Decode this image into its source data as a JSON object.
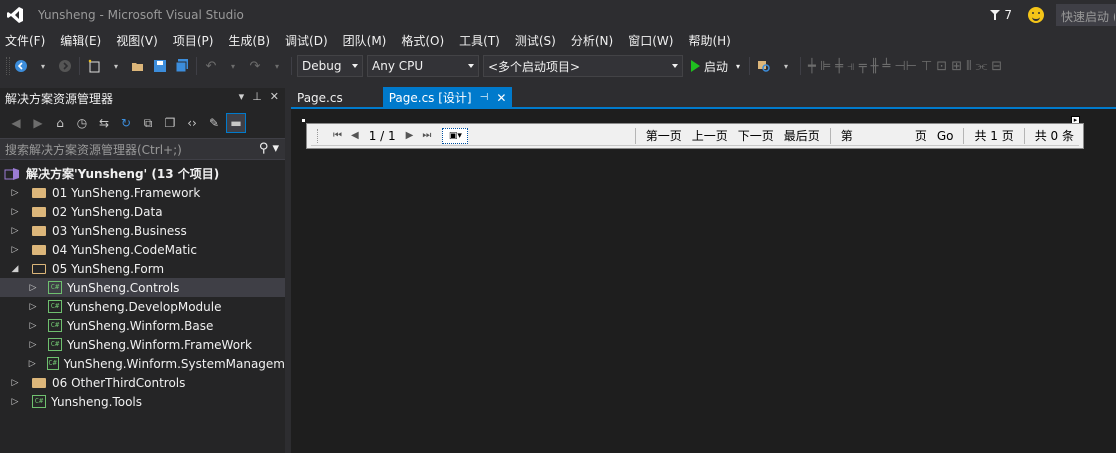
{
  "window": {
    "title": "Yunsheng - Microsoft Visual Studio",
    "notifications_count": "7",
    "quick_launch_placeholder": "快速启动 (",
    "accent_color": "#007acc"
  },
  "menu": [
    "文件(F)",
    "编辑(E)",
    "视图(V)",
    "项目(P)",
    "生成(B)",
    "调试(D)",
    "团队(M)",
    "格式(O)",
    "工具(T)",
    "测试(S)",
    "分析(N)",
    "窗口(W)",
    "帮助(H)"
  ],
  "toolbar": {
    "configuration": "Debug",
    "platform": "Any CPU",
    "startup_project": "<多个启动项目>",
    "start_label": "启动"
  },
  "solution_explorer": {
    "title": "解决方案资源管理器",
    "search_placeholder": "搜索解决方案资源管理器(Ctrl+;)",
    "solution_label": "解决方案'Yunsheng' (13 个项目)",
    "items": [
      {
        "label": "01 YunSheng.Framework",
        "type": "folder",
        "expander": "▷"
      },
      {
        "label": "02 YunSheng.Data",
        "type": "folder",
        "expander": "▷"
      },
      {
        "label": "03 YunSheng.Business",
        "type": "folder",
        "expander": "▷"
      },
      {
        "label": "04 YunSheng.CodeMatic",
        "type": "folder",
        "expander": "▷"
      },
      {
        "label": "05 YunSheng.Form",
        "type": "folder-open",
        "expander": "◢"
      },
      {
        "label": "YunSheng.Controls",
        "type": "csproj",
        "expander": "▷"
      },
      {
        "label": "Yunsheng.DevelopModule",
        "type": "csproj",
        "expander": "▷"
      },
      {
        "label": "YunSheng.Winform.Base",
        "type": "csproj",
        "expander": "▷"
      },
      {
        "label": "YunSheng.Winform.FrameWork",
        "type": "csproj",
        "expander": "▷"
      },
      {
        "label": "YunSheng.Winform.SystemManagem",
        "type": "csproj",
        "expander": "▷"
      },
      {
        "label": "06 OtherThirdControls",
        "type": "folder",
        "expander": "▷"
      },
      {
        "label": "Yunsheng.Tools",
        "type": "csproj",
        "expander": "▷"
      }
    ]
  },
  "tabs": [
    {
      "label": "Page.cs",
      "active": false
    },
    {
      "label": "Page.cs [设计]",
      "active": true
    }
  ],
  "designer": {
    "page_indicator": "1 / 1",
    "first_page": "第一页",
    "prev_page": "上一页",
    "next_page": "下一页",
    "last_page": "最后页",
    "goto_prefix": "第",
    "goto_suffix": "页",
    "go_label": "Go",
    "total_pages": "共 1 页",
    "total_items": "共 0 条"
  }
}
